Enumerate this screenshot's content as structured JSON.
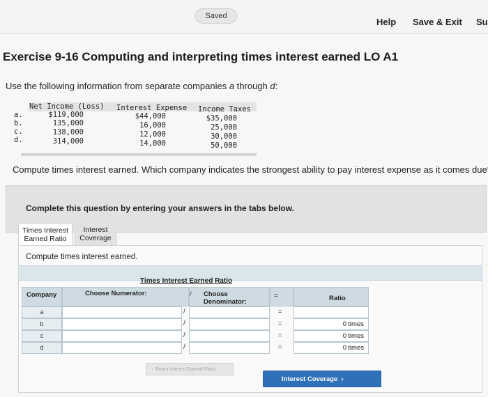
{
  "header": {
    "saved_label": "Saved",
    "help_label": "Help",
    "save_exit_label": "Save & Exit",
    "submit_label": "Sul"
  },
  "exercise": {
    "title": "Exercise 9-16 Computing and interpreting times interest earned LO A1",
    "intro_prefix": "Use the following information from separate companies ",
    "intro_italic": "a",
    "intro_mid": " through ",
    "intro_italic2": "d",
    "intro_suffix": ":"
  },
  "data_table": {
    "headers": [
      "Net Income (Loss)",
      "Interest Expense",
      "Income Taxes"
    ],
    "rows": [
      {
        "label": "a.",
        "net_income": "$119,000",
        "interest": "$44,000",
        "taxes": "$35,000"
      },
      {
        "label": "b.",
        "net_income": "135,000",
        "interest": "16,000",
        "taxes": "25,000"
      },
      {
        "label": "c.",
        "net_income": "138,000",
        "interest": "12,000",
        "taxes": "30,000"
      },
      {
        "label": "d.",
        "net_income": "314,000",
        "interest": "14,000",
        "taxes": "50,000"
      }
    ]
  },
  "question": "Compute times interest earned. Which company indicates the strongest ability to pay interest expense as it comes due?",
  "instruction": "Complete this question by entering your answers in the tabs below.",
  "tabs": [
    {
      "label_line1": "Times Interest",
      "label_line2": "Earned Ratio",
      "active": true
    },
    {
      "label_line1": "Interest",
      "label_line2": "Coverage",
      "active": false
    }
  ],
  "panel": {
    "compute_label": "Compute times interest earned.",
    "grid_title": "Times Interest Earned Ratio",
    "col_company": "Company",
    "col_numerator": "Choose Numerator:",
    "col_divide": "/",
    "col_denominator": "Choose Denominator:",
    "col_equals": "=",
    "col_ratio": "Ratio",
    "rows": [
      {
        "company": "a",
        "ratio_value": "",
        "ratio_unit": ""
      },
      {
        "company": "b",
        "ratio_value": "0",
        "ratio_unit": "times"
      },
      {
        "company": "c",
        "ratio_value": "0",
        "ratio_unit": "times"
      },
      {
        "company": "d",
        "ratio_value": "0",
        "ratio_unit": "times"
      }
    ],
    "prev_button": "Times Interest Earned Ratio",
    "next_button": "Interest Coverage"
  },
  "colors": {
    "accent": "#2f71b8",
    "grid_header": "#cfdbe2"
  }
}
